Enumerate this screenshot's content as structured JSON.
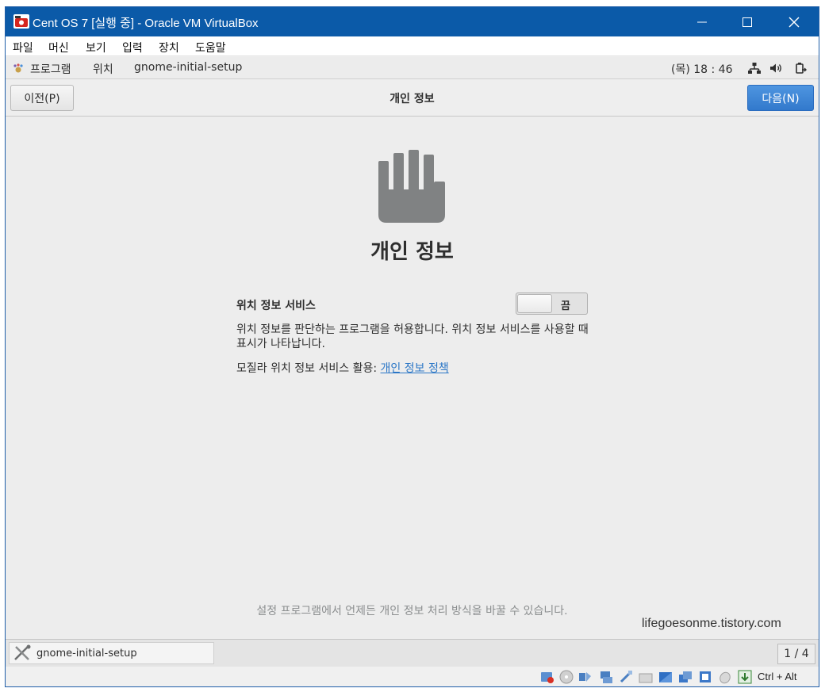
{
  "window": {
    "title": "Cent OS 7 [실행 중] - Oracle VM VirtualBox",
    "minimize_glyph": "—",
    "maximize_glyph": "☐",
    "close_glyph": "✕"
  },
  "menubar": [
    "파일",
    "머신",
    "보기",
    "입력",
    "장치",
    "도움말"
  ],
  "topbar": {
    "applications": "프로그램",
    "places": "위치",
    "app_name": "gnome-initial-setup",
    "clock": "(목) 18 : 46"
  },
  "header": {
    "prev_label": "이전(P)",
    "title": "개인 정보",
    "next_label": "다음(N)"
  },
  "content": {
    "heading": "개인 정보",
    "location_label": "위치 정보 서비스",
    "toggle_state": "끔",
    "description": "위치 정보를 판단하는 프로그램을 허용합니다. 위치 정보 서비스를 사용할 때 표시가 나타납니다.",
    "mozilla_text": "모질라 위치 정보 서비스 활용: ",
    "policy_link": "개인 정보 정책",
    "footer_note": "설정 프로그램에서 언제든 개인 정보 처리 방식을 바꿀 수 있습니다.",
    "watermark": "lifegoesonme.tistory.com"
  },
  "taskbar": {
    "task_label": "gnome-initial-setup",
    "pager": "1 / 4"
  },
  "statusbar": {
    "host_key": "Ctrl + Alt",
    "icons": [
      "hdd-icon",
      "optical-disk-icon",
      "audio-icon",
      "network-icon",
      "usb-icon",
      "shared-folder-icon",
      "display-icon",
      "recording-icon",
      "cpu-icon",
      "mouse-integration-icon",
      "download-icon"
    ]
  },
  "colors": {
    "titlebar": "#0b5aa8",
    "accent_button": "#3c86d6",
    "link": "#2a76c6",
    "hand_icon": "#808283"
  }
}
